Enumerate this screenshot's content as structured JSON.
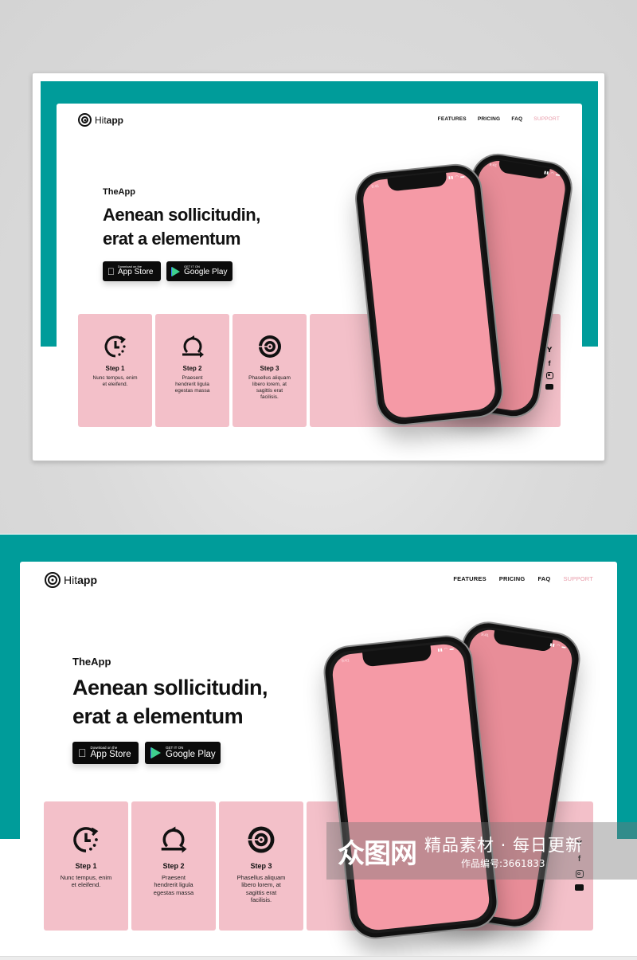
{
  "brand": {
    "logo_light": "Hit",
    "logo_bold": "app"
  },
  "nav": {
    "items": [
      "FEATURES",
      "PRICING",
      "FAQ",
      "SUPPORT"
    ],
    "active_accent": "#e89aa8"
  },
  "hero": {
    "eyebrow": "TheApp",
    "headline_line1": "Aenean sollicitudin,",
    "headline_line2": "erat a elementum"
  },
  "store_badges": {
    "app_store": {
      "small": "Download on the",
      "big": "App Store"
    },
    "google_play": {
      "small": "GET IT ON",
      "big": "Google Play"
    }
  },
  "steps": [
    {
      "icon": "clock-refresh-icon",
      "title": "Step 1",
      "desc_lines": [
        "Nunc tempus, enim",
        "et eleifend."
      ]
    },
    {
      "icon": "loop-arrow-icon",
      "title": "Step 2",
      "desc_lines": [
        "Praesent",
        "hendrerit ligula",
        "egestas massa"
      ]
    },
    {
      "icon": "target-icon",
      "title": "Step 3",
      "desc_lines": [
        "Phasellus aliquam",
        "libero lorem, at",
        "sagittis erat",
        "facilisis."
      ]
    }
  ],
  "social": [
    "twitter-icon",
    "facebook-icon",
    "instagram-icon",
    "youtube-icon"
  ],
  "phone": {
    "time": "9:41"
  },
  "colors": {
    "teal": "#009c9a",
    "card_pink": "#f3c0c9",
    "screen_pink": "#f59aa6",
    "screen_pink_back": "#e88d98"
  },
  "watermark": {
    "logo": "众图网",
    "tagline": "精品素材 · 每日更新",
    "work_id": "作品编号:3661833"
  }
}
